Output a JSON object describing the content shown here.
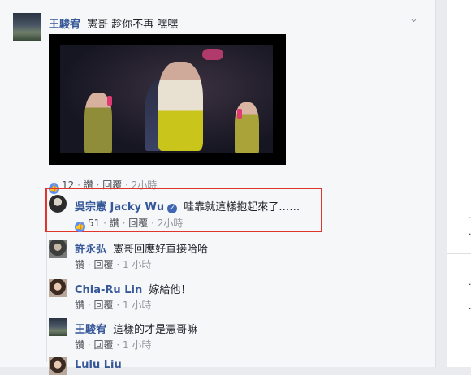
{
  "post": {
    "author": "王駿宥",
    "text": "憲哥 趁你不再 嘿嘿",
    "reactions_count": "12",
    "read_label": "讚",
    "reply_label": "回覆",
    "time": "2小時"
  },
  "replies": [
    {
      "author": "吳宗憲 Jacky Wu",
      "verified": true,
      "text": "哇靠就這樣抱起來了……",
      "reactions_count": "51",
      "read_label": "讚",
      "reply_label": "回覆",
      "time": "2小時"
    },
    {
      "author": "許永弘",
      "text": "憲哥回應好直接哈哈",
      "read_label": "讚",
      "reply_label": "回覆",
      "time": "1 小時"
    },
    {
      "author": "Chia-Ru Lin",
      "text": "嫁給他！",
      "read_label": "讚",
      "reply_label": "回覆",
      "time": "1 小時"
    },
    {
      "author": "王駿宥",
      "text": "這樣的才是憲哥嘛",
      "read_label": "讚",
      "reply_label": "回覆",
      "time": "1 小時"
    },
    {
      "author": "Lulu Liu"
    }
  ],
  "separator": "·",
  "icons": {
    "chevron": "chevron-down-icon",
    "like": "like-reaction-icon",
    "verified": "verified-badge-icon"
  },
  "colors": {
    "name_link": "#365899",
    "highlight_box": "#e0342c",
    "like_blue": "#5890ff"
  }
}
